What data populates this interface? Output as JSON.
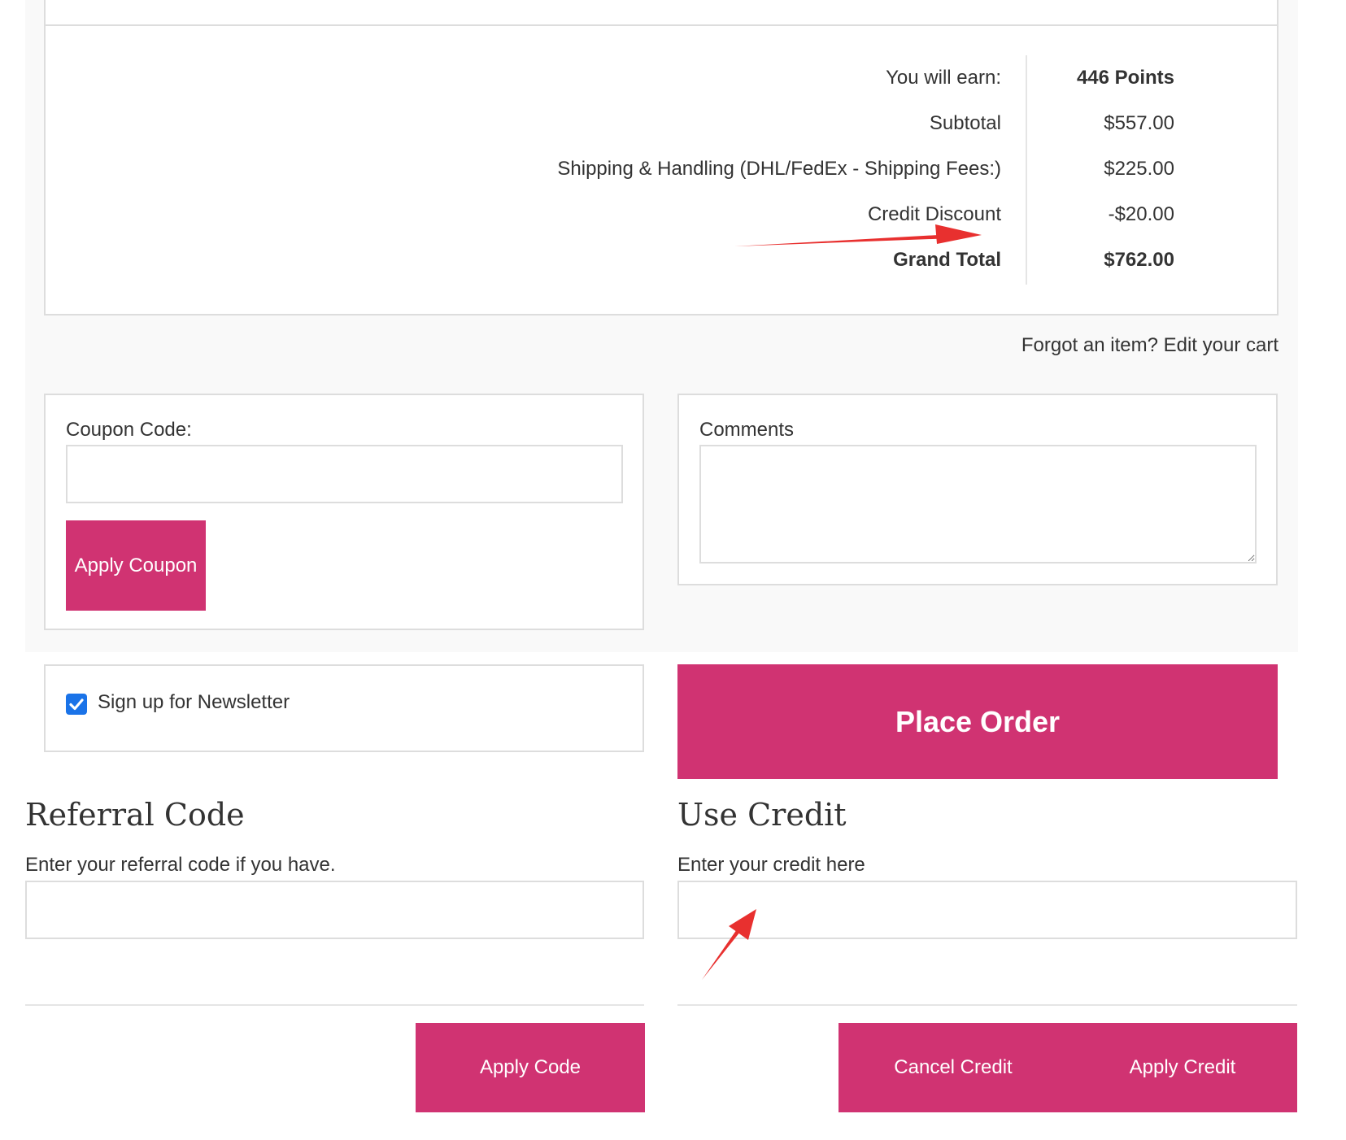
{
  "totals": {
    "rows": [
      {
        "label": "You will earn:",
        "value": "446 Points"
      },
      {
        "label": "Subtotal",
        "value": "$557.00"
      },
      {
        "label": "Shipping & Handling (DHL/FedEx - Shipping Fees:)",
        "value": "$225.00"
      },
      {
        "label": "Credit Discount",
        "value": "-$20.00"
      },
      {
        "label": "Grand Total",
        "value": "$762.00"
      }
    ],
    "edit_cart_link": "Forgot an item? Edit your cart"
  },
  "coupon": {
    "label": "Coupon Code:",
    "value": "",
    "button": "Apply Coupon"
  },
  "comments": {
    "label": "Comments",
    "value": ""
  },
  "newsletter": {
    "label": "Sign up for Newsletter",
    "checked": true
  },
  "place_order": {
    "label": "Place Order"
  },
  "referral": {
    "title": "Referral Code",
    "label": "Enter your referral code if you have.",
    "value": "",
    "button": "Apply Code"
  },
  "credit": {
    "title": "Use Credit",
    "label": "Enter your credit here",
    "value": "",
    "cancel_button": "Cancel Credit",
    "apply_button": "Apply Credit"
  },
  "colors": {
    "accent": "#d03372",
    "annotation": "#e8302f",
    "checkbox": "#1a73e8"
  }
}
